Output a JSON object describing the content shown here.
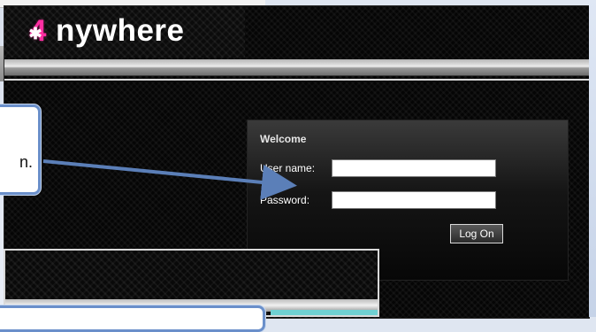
{
  "logo": {
    "mark": "4",
    "star": "✱",
    "text": "nywhere"
  },
  "welcome_panel": {
    "title": "Welcome",
    "username_label": "User name:",
    "password_label": "Password:",
    "username_value": "",
    "password_value": "",
    "logon_button": "Log On"
  },
  "callout_main": {
    "visible_text": "n."
  },
  "colors": {
    "brand_pink": "#ff2fa2",
    "callout_border": "#6a8fca",
    "arrow": "#5b7fb8",
    "teal_bar": "#6fd0d2"
  },
  "icons": {
    "logo": "anywhere-logo",
    "arrow": "pointer-arrow"
  }
}
